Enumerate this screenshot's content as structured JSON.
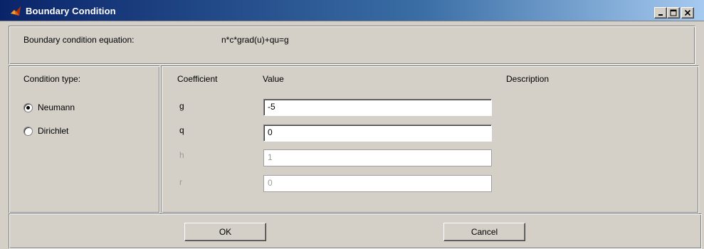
{
  "window": {
    "title": "Boundary Condition",
    "controls": {
      "minimize": "_",
      "maximize": "□",
      "close": "×"
    }
  },
  "equation": {
    "label": "Boundary condition equation:",
    "value": "n*c*grad(u)+qu=g"
  },
  "condition": {
    "label": "Condition type:",
    "options": [
      {
        "label": "Neumann",
        "checked": true
      },
      {
        "label": "Dirichlet",
        "checked": false
      }
    ]
  },
  "table": {
    "headers": {
      "coefficient": "Coefficient",
      "value": "Value",
      "description": "Description"
    },
    "rows": [
      {
        "name": "g",
        "value": "-5",
        "enabled": true
      },
      {
        "name": "q",
        "value": "0",
        "enabled": true
      },
      {
        "name": "h",
        "value": "1",
        "enabled": false
      },
      {
        "name": "r",
        "value": "0",
        "enabled": false
      }
    ]
  },
  "buttons": {
    "ok": "OK",
    "cancel": "Cancel"
  },
  "colors": {
    "titlebar_start": "#0a246a",
    "titlebar_end": "#a6caf0",
    "face": "#d4d0c8",
    "disabled_text": "#9a9a9a"
  },
  "icons": {
    "app": "matlab-logo-icon"
  }
}
